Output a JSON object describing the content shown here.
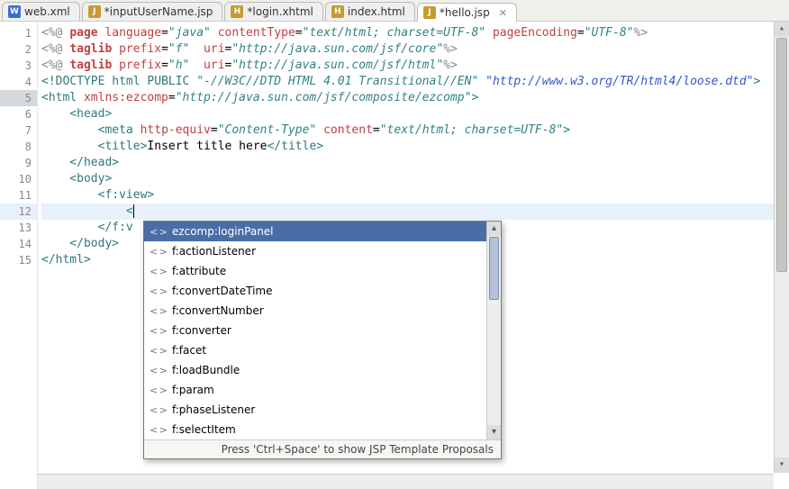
{
  "tabs": [
    {
      "label": "web.xml",
      "iconClass": "web",
      "iconText": "W",
      "active": false,
      "dirty": false
    },
    {
      "label": "*inputUserName.jsp",
      "iconClass": "jsp",
      "iconText": "J",
      "active": false,
      "dirty": true
    },
    {
      "label": "*login.xhtml",
      "iconClass": "html",
      "iconText": "H",
      "active": false,
      "dirty": true
    },
    {
      "label": "index.html",
      "iconClass": "html",
      "iconText": "H",
      "active": false,
      "dirty": false
    },
    {
      "label": "*hello.jsp",
      "iconClass": "jsp",
      "iconText": "J",
      "active": true,
      "dirty": true
    }
  ],
  "lines": [
    "1",
    "2",
    "3",
    "4",
    "5",
    "6",
    "7",
    "8",
    "9",
    "10",
    "11",
    "12",
    "13",
    "14",
    "15"
  ],
  "code": {
    "l1": {
      "a": "<%@ ",
      "b": "page ",
      "c": "language",
      "d": "=",
      "e": "\"java\"",
      "f": " contentType",
      "g": "=",
      "h": "\"text/html; charset=UTF-8\"",
      "i": " pageEncoding",
      "j": "=",
      "k": "\"UTF-8\"",
      "l": "%>"
    },
    "l2": {
      "a": "<%@ ",
      "b": "taglib ",
      "c": "prefix",
      "d": "=",
      "e": "\"f\"",
      "f": "  uri",
      "g": "=",
      "h": "\"http://java.sun.com/jsf/core\"",
      "i": "%>"
    },
    "l3": {
      "a": "<%@ ",
      "b": "taglib ",
      "c": "prefix",
      "d": "=",
      "e": "\"h\"",
      "f": "  uri",
      "g": "=",
      "h": "\"http://java.sun.com/jsf/html\"",
      "i": "%>"
    },
    "l4": {
      "a": "<!DOCTYPE ",
      "b": "html ",
      "c": "PUBLIC ",
      "d": "\"-//W3C//DTD HTML 4.01 Transitional//EN\" ",
      "e": "\"http://www.w3.org/TR/html4/loose.dtd\"",
      "f": ">"
    },
    "l5": {
      "a": "<",
      "b": "html ",
      "c": "xmlns:ezcomp",
      "d": "=",
      "e": "\"http://java.sun.com/jsf/composite/ezcomp\"",
      "f": ">"
    },
    "l6": {
      "a": "    <",
      "b": "head",
      "c": ">"
    },
    "l7": {
      "a": "        <",
      "b": "meta ",
      "c": "http-equiv",
      "d": "=",
      "e": "\"Content-Type\"",
      "f": " content",
      "g": "=",
      "h": "\"text/html; charset=UTF-8\"",
      "i": ">"
    },
    "l8": {
      "a": "        <",
      "b": "title",
      "c": ">",
      "d": "Insert title here",
      "e": "</",
      "f": "title",
      "g": ">"
    },
    "l9": {
      "a": "    </",
      "b": "head",
      "c": ">"
    },
    "l10": {
      "a": "    <",
      "b": "body",
      "c": ">"
    },
    "l11": {
      "a": "        <",
      "b": "f:view",
      "c": ">"
    },
    "l12": {
      "a": "            <"
    },
    "l13": {
      "a": "        </",
      "b": "f:v"
    },
    "l14": {
      "a": "    </",
      "b": "body",
      "c": ">"
    },
    "l15": {
      "a": "</",
      "b": "html",
      "c": ">"
    }
  },
  "popup": {
    "items": [
      "ezcomp:loginPanel",
      "f:actionListener",
      "f:attribute",
      "f:convertDateTime",
      "f:convertNumber",
      "f:converter",
      "f:facet",
      "f:loadBundle",
      "f:param",
      "f:phaseListener",
      "f:selectItem"
    ],
    "selectedIndex": 0,
    "hint": "Press 'Ctrl+Space' to show JSP Template Proposals"
  }
}
